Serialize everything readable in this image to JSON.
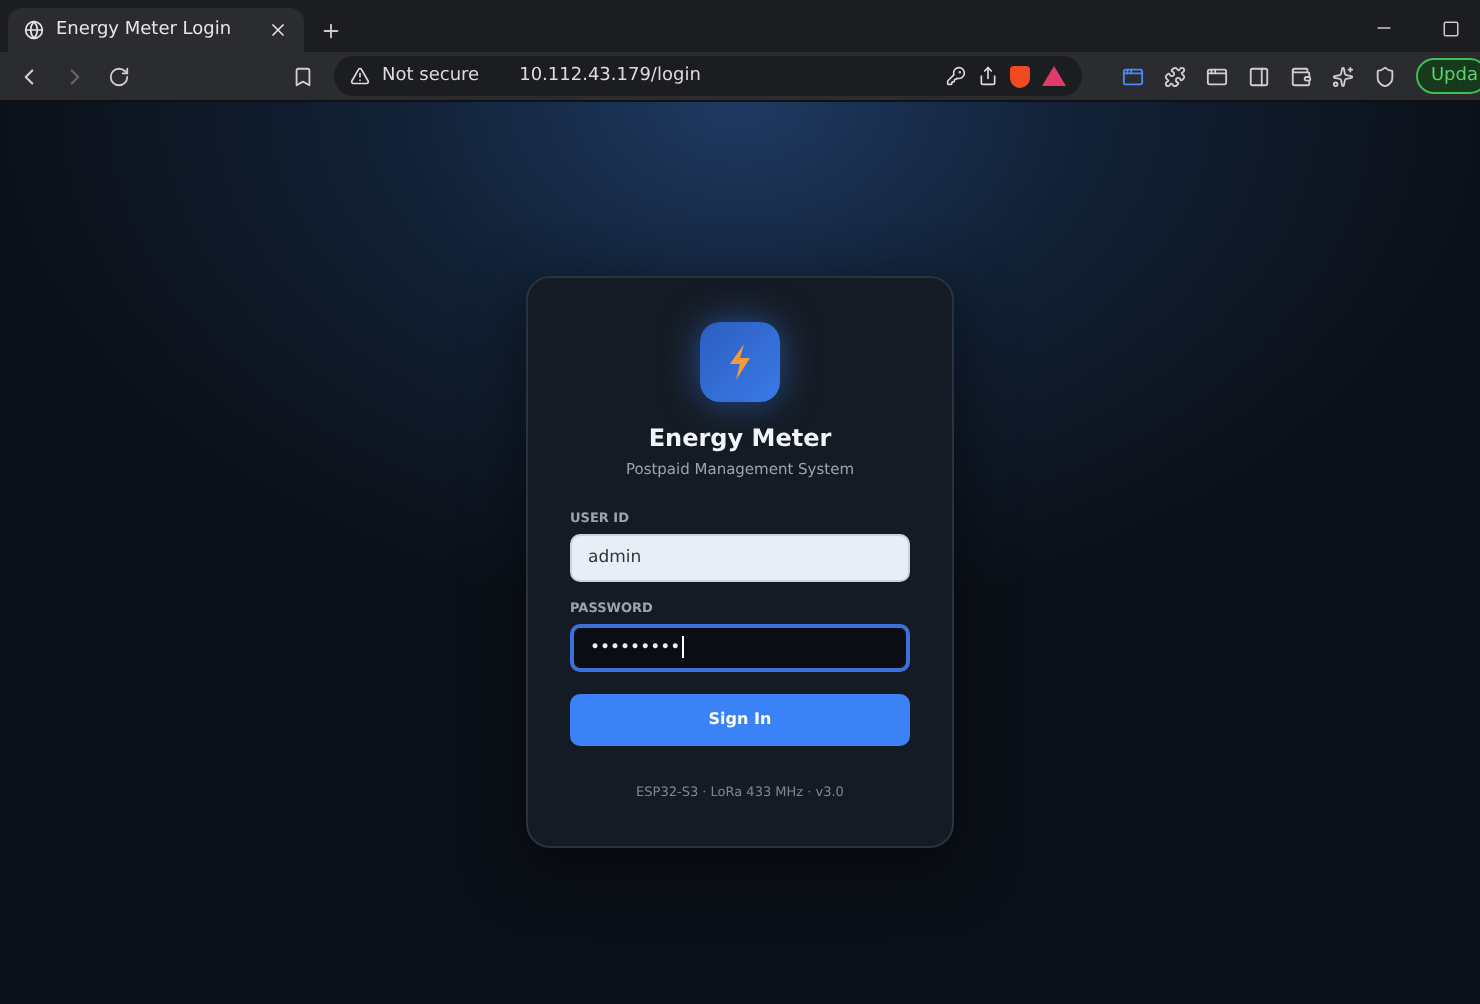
{
  "browser": {
    "tab_title": "Energy Meter Login",
    "security_label": "Not secure",
    "url": "10.112.43.179/login",
    "update_label": "Upda"
  },
  "login": {
    "title": "Energy Meter",
    "subtitle": "Postpaid Management System",
    "fields": [
      {
        "label": "USER ID",
        "value": "admin",
        "kind": "text",
        "focused": false
      },
      {
        "label": "PASSWORD",
        "value": "•••••••••",
        "kind": "password",
        "focused": true
      }
    ],
    "button": "Sign In",
    "footer": "ESP32-S3 · LoRa 433 MHz · v3.0"
  }
}
